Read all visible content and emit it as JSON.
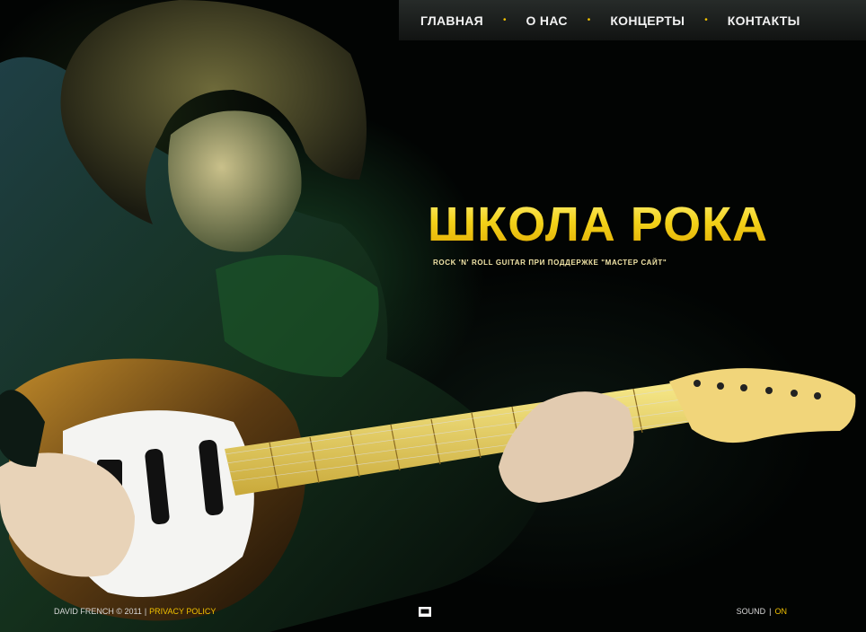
{
  "nav": {
    "items": [
      {
        "label": "ГЛАВНАЯ"
      },
      {
        "label": "О НАС"
      },
      {
        "label": "КОНЦЕРТЫ"
      },
      {
        "label": "КОНТАКТЫ"
      }
    ],
    "separator": "•"
  },
  "hero": {
    "title": "ШКОЛА РОКА",
    "tagline": "ROCK 'N' ROLL GUITAR ПРИ ПОДДЕРЖКЕ \"МАСТЕР САЙТ\"",
    "image": "rock-guitarist-photo"
  },
  "footer": {
    "copyright": "DAVID FRENCH © 2011",
    "divider": "|",
    "privacy_label": "PRIVACY POLICY",
    "sound_label": "SOUND",
    "sound_state": "ON",
    "fullscreen_icon": "fullscreen-icon"
  },
  "colors": {
    "accent": "#f2c200",
    "nav_text": "#f2f2f2",
    "background": "#020403"
  }
}
